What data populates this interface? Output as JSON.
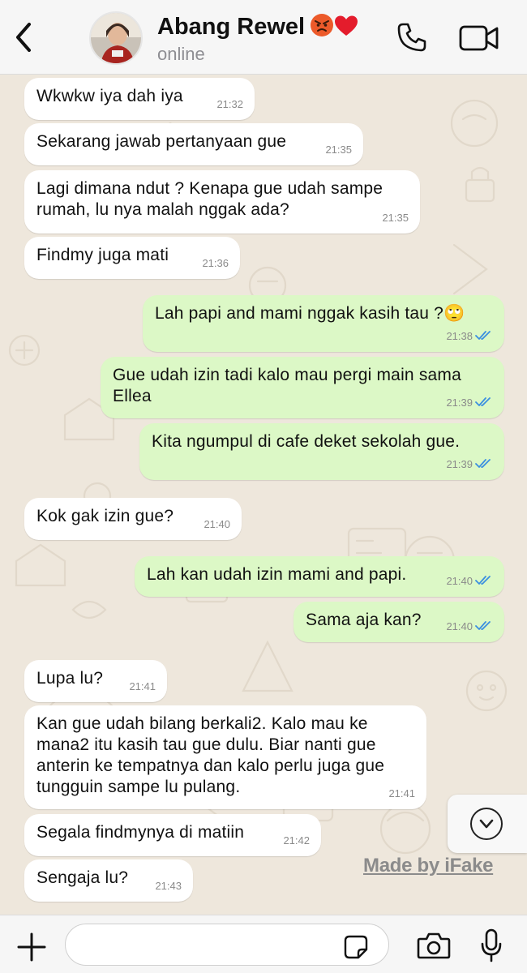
{
  "header": {
    "contact_name": "Abang Rewel",
    "status": "online",
    "name_emojis": [
      "angry-face-emoji",
      "red-heart-emoji"
    ]
  },
  "messages": [
    {
      "dir": "in",
      "text": "Wkwkw iya dah iya",
      "time": "21:32"
    },
    {
      "dir": "in",
      "text": "Sekarang jawab pertanyaan gue",
      "time": "21:35"
    },
    {
      "dir": "in",
      "text": "Lagi dimana ndut ? Kenapa gue udah sampe rumah, lu nya malah nggak ada?",
      "time": "21:35"
    },
    {
      "dir": "in",
      "text": "Findmy juga mati",
      "time": "21:36"
    },
    {
      "dir": "out",
      "text": "Lah papi and mami nggak kasih tau ?🙄",
      "time": "21:38",
      "read": true
    },
    {
      "dir": "out",
      "text": "Gue udah izin tadi kalo mau pergi main sama Ellea",
      "time": "21:39",
      "read": true
    },
    {
      "dir": "out",
      "text": "Kita ngumpul di cafe deket sekolah gue.",
      "time": "21:39",
      "read": true
    },
    {
      "dir": "in",
      "text": "Kok gak izin gue?",
      "time": "21:40"
    },
    {
      "dir": "out",
      "text": "Lah kan udah izin mami and papi.",
      "time": "21:40",
      "read": true
    },
    {
      "dir": "out",
      "text": "Sama aja kan?",
      "time": "21:40",
      "read": true
    },
    {
      "dir": "in",
      "text": "Lupa lu?",
      "time": "21:41"
    },
    {
      "dir": "in",
      "text": "Kan gue udah bilang berkali2. Kalo mau ke mana2 itu kasih tau gue dulu. Biar nanti gue anterin ke tempatnya dan kalo perlu juga gue tungguin sampe lu pulang.",
      "time": "21:41"
    },
    {
      "dir": "in",
      "text": "Segala findmynya di matiin",
      "time": "21:42"
    },
    {
      "dir": "in",
      "text": "Sengaja lu?",
      "time": "21:43"
    }
  ],
  "watermark": "Made by iFake",
  "input": {
    "value": "",
    "placeholder": ""
  },
  "icons": {
    "back": "chevron-left-icon",
    "phone": "phone-icon",
    "video": "video-camera-icon",
    "scroll_down": "chevron-down-circle-icon",
    "plus": "plus-icon",
    "sticker": "sticker-icon",
    "camera": "camera-icon",
    "mic": "microphone-icon",
    "read_receipt": "double-check-icon"
  },
  "colors": {
    "incoming_bubble": "#ffffff",
    "outgoing_bubble": "#dcf8c6",
    "chat_background": "#eee7dc",
    "read_tick": "#3b8fe0"
  }
}
